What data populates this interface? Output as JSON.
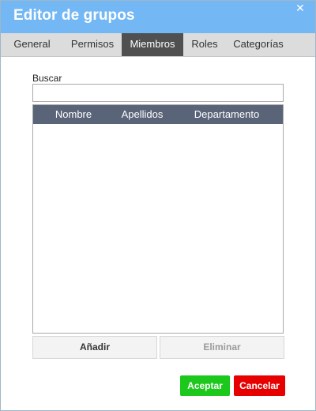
{
  "window": {
    "title": "Editor de grupos",
    "close_glyph": "✕"
  },
  "tabs": [
    {
      "label": "General",
      "active": false
    },
    {
      "label": "Permisos",
      "active": false
    },
    {
      "label": "Miembros",
      "active": true
    },
    {
      "label": "Roles",
      "active": false
    },
    {
      "label": "Categorías",
      "active": false
    }
  ],
  "search": {
    "label": "Buscar",
    "value": "",
    "placeholder": ""
  },
  "table": {
    "columns": [
      "Nombre",
      "Apellidos",
      "Departamento"
    ],
    "rows": []
  },
  "actions": {
    "add_label": "Añadir",
    "remove_label": "Eliminar",
    "remove_enabled": false
  },
  "footer": {
    "accept_label": "Aceptar",
    "cancel_label": "Cancelar"
  },
  "colors": {
    "titlebar": "#73b7f4",
    "tab_active": "#505050",
    "table_header": "#5a6479",
    "accept": "#1bc81b",
    "cancel": "#e60000"
  },
  "icons": {
    "close": "close-icon"
  }
}
